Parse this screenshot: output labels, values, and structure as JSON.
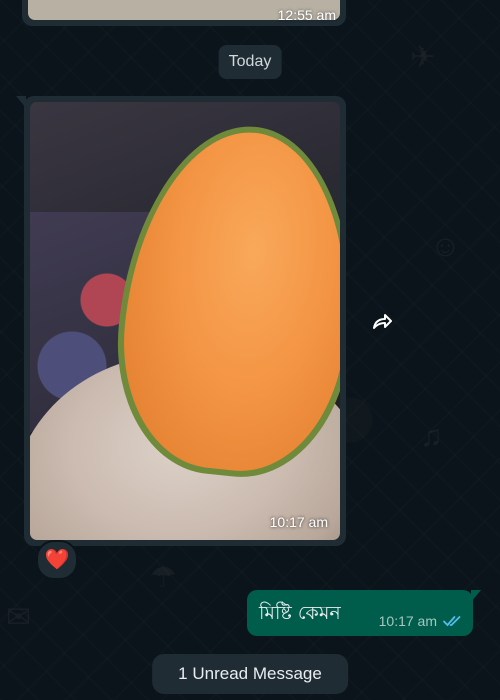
{
  "previous_message": {
    "time": "12:55 am"
  },
  "date_separator": "Today",
  "image_message": {
    "time": "10:17 am",
    "reaction": "❤️"
  },
  "outgoing_message": {
    "text": "মিষ্টি কেমন",
    "time": "10:17 am",
    "status": "read"
  },
  "unread_banner": "1 Unread Message",
  "colors": {
    "chat_background": "#0b141a",
    "incoming_bubble": "#1f2c34",
    "outgoing_bubble": "#005c4b",
    "read_ticks": "#53bdeb"
  }
}
